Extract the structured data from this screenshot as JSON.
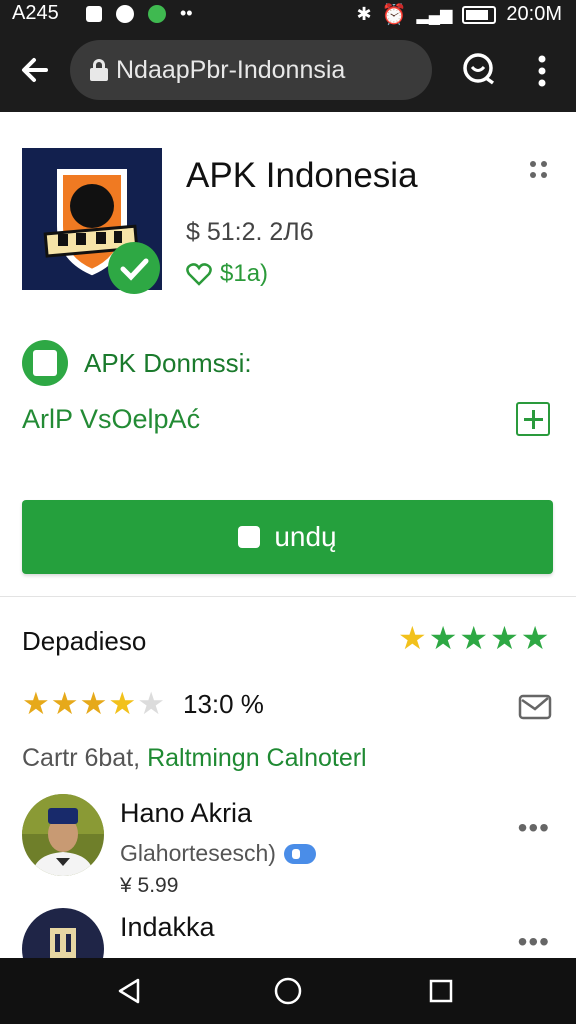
{
  "status_bar": {
    "time": "A245",
    "clock": "20:0M"
  },
  "browser": {
    "url": "NdaapPbr-Indonnsia"
  },
  "app": {
    "title": "APK Indonesia",
    "price": "$ 51:2. 2Л6",
    "likes": "$1a)",
    "developer": "APK Donmssi:",
    "subtitle": "ArlP VsOelpAć",
    "install_label": "undų"
  },
  "ratings_section": {
    "title": "Depadieso",
    "top_stars": 5,
    "rating_stars": 4,
    "rating_value": "13:0 %",
    "meta_prefix": "Cartr 6bat,",
    "meta_link": "Raltmingn Calnoterl"
  },
  "reviews": [
    {
      "name": "Hano Akria",
      "subtitle": "Glahortesesch)",
      "price": "¥ 5.99"
    },
    {
      "name": "Indakka"
    }
  ],
  "colors": {
    "accent_green": "#25a03d",
    "dark_bar": "#1c1c1c",
    "star_yellow": "#f2c11b",
    "star_green": "#2ea844"
  }
}
